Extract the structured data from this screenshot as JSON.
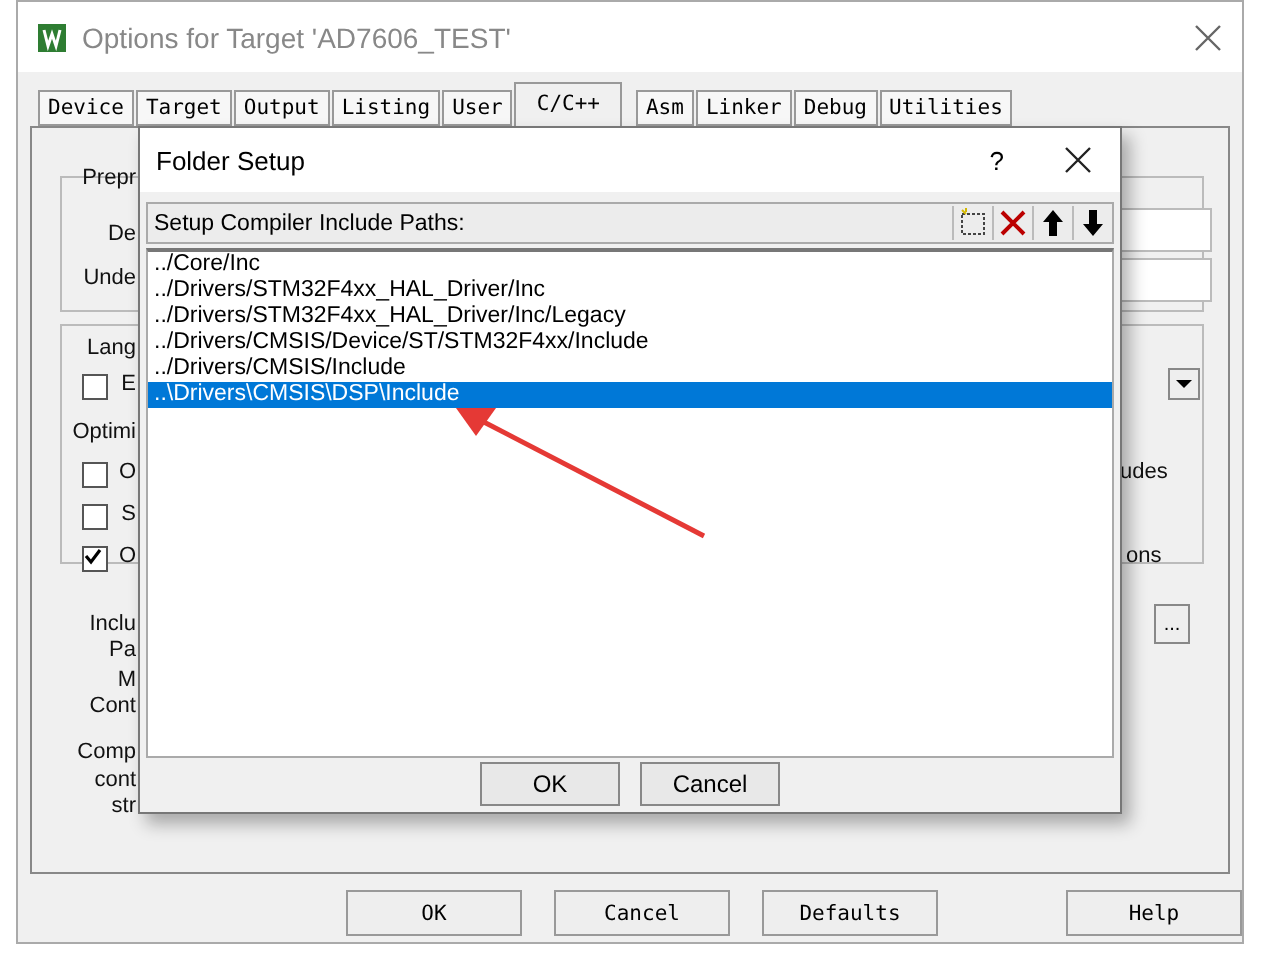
{
  "window": {
    "title": "Options for Target 'AD7606_TEST'"
  },
  "tabs": [
    {
      "label": "Device",
      "selected": false
    },
    {
      "label": "Target",
      "selected": false
    },
    {
      "label": "Output",
      "selected": false
    },
    {
      "label": "Listing",
      "selected": false
    },
    {
      "label": "User",
      "selected": false
    },
    {
      "label": "C/C++",
      "selected": true
    },
    {
      "label": "Asm",
      "selected": false
    },
    {
      "label": "Linker",
      "selected": false
    },
    {
      "label": "Debug",
      "selected": false
    },
    {
      "label": "Utilities",
      "selected": false
    }
  ],
  "form": [
    {
      "kind": "label",
      "text": "Prepr"
    },
    {
      "kind": "label",
      "text": "De"
    },
    {
      "kind": "label",
      "text": "Unde"
    },
    {
      "kind": "label",
      "text": "Lang"
    },
    {
      "kind": "checkbox",
      "text": "E",
      "checked": false
    },
    {
      "kind": "label",
      "text": "Optimi"
    },
    {
      "kind": "checkbox",
      "text": "O",
      "checked": false
    },
    {
      "kind": "checkbox",
      "text": "S",
      "checked": false
    },
    {
      "kind": "checkbox",
      "text": "O",
      "checked": true
    },
    {
      "kind": "label",
      "text": "Inclu"
    },
    {
      "kind": "label",
      "text": "Pa"
    },
    {
      "kind": "label",
      "text": "M"
    },
    {
      "kind": "label",
      "text": "Cont"
    },
    {
      "kind": "label",
      "text": "Comp"
    },
    {
      "kind": "label",
      "text": "cont"
    },
    {
      "kind": "label",
      "text": "str"
    },
    {
      "kind": "label",
      "text": "udes"
    },
    {
      "kind": "label",
      "text": "ons"
    },
    {
      "kind": "button",
      "text": "..."
    }
  ],
  "dialog": {
    "title": "Folder Setup",
    "help": "?",
    "list_label": "Setup Compiler Include Paths:",
    "paths": [
      {
        "text": "../Core/Inc",
        "selected": false
      },
      {
        "text": "../Drivers/STM32F4xx_HAL_Driver/Inc",
        "selected": false
      },
      {
        "text": "../Drivers/STM32F4xx_HAL_Driver/Inc/Legacy",
        "selected": false
      },
      {
        "text": "../Drivers/CMSIS/Device/ST/STM32F4xx/Include",
        "selected": false
      },
      {
        "text": "../Drivers/CMSIS/Include",
        "selected": false
      },
      {
        "text": "..\\Drivers\\CMSIS\\DSP\\Include",
        "selected": true
      }
    ],
    "buttons": [
      "OK",
      "Cancel"
    ]
  },
  "buttons": [
    "OK",
    "Cancel",
    "Defaults",
    "Help"
  ]
}
